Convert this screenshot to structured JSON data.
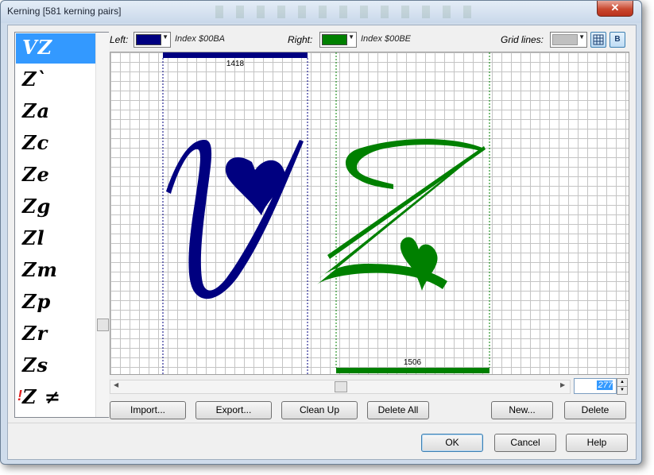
{
  "window": {
    "title": "Kerning [581 kerning pairs]",
    "close_label": "✕"
  },
  "pairs_list": {
    "items": [
      {
        "text": "VZ",
        "selected": true,
        "warning": false
      },
      {
        "text": "Z`",
        "selected": false,
        "warning": false
      },
      {
        "text": "Za",
        "selected": false,
        "warning": false
      },
      {
        "text": "Zc",
        "selected": false,
        "warning": false
      },
      {
        "text": "Ze",
        "selected": false,
        "warning": false
      },
      {
        "text": "Zg",
        "selected": false,
        "warning": false
      },
      {
        "text": "Zl",
        "selected": false,
        "warning": false
      },
      {
        "text": "Zm",
        "selected": false,
        "warning": false
      },
      {
        "text": "Zp",
        "selected": false,
        "warning": false
      },
      {
        "text": "Zr",
        "selected": false,
        "warning": false
      },
      {
        "text": "Zs",
        "selected": false,
        "warning": false
      },
      {
        "text": "Z ≠",
        "selected": false,
        "warning": true,
        "warning_mark": "!"
      }
    ]
  },
  "toolbar": {
    "left_label": "Left:",
    "left_color": "#000080",
    "left_index": "Index $00BA",
    "right_label": "Right:",
    "right_color": "#008000",
    "right_index": "Index $00BE",
    "grid_label": "Grid lines:",
    "grid_color": "#c0c0c0",
    "grid_btn_label": "",
    "b_btn_label": "B"
  },
  "canvas": {
    "left_width_label": "1418",
    "right_width_label": "1506",
    "left_glyph_color": "#000080",
    "right_glyph_color": "#008000"
  },
  "kerning_value": "277",
  "buttons": {
    "import": "Import...",
    "export": "Export...",
    "cleanup": "Clean Up",
    "delete_all": "Delete All",
    "new": "New...",
    "delete": "Delete",
    "ok": "OK",
    "cancel": "Cancel",
    "help": "Help"
  }
}
